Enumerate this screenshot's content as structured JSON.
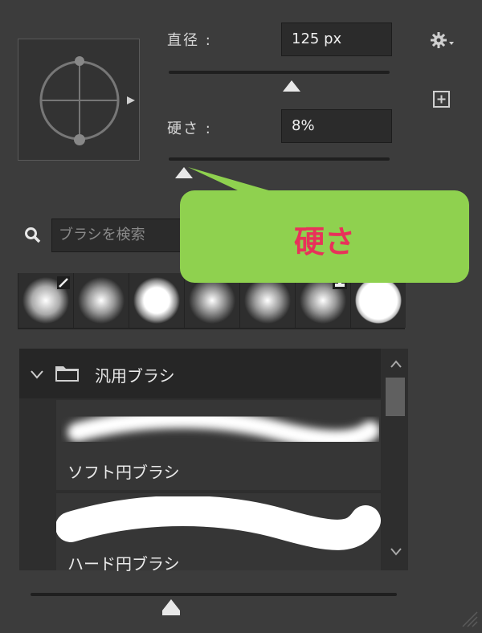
{
  "brush_settings": {
    "size_label": "直径 :",
    "size_value": "125 px",
    "size_level": 0.55,
    "hardness_label": "硬さ :",
    "hardness_value": "8%",
    "hardness_level": 0.08,
    "gear_icon": "gear-icon",
    "new_preset_icon": "plus-square-icon"
  },
  "search": {
    "placeholder": "ブラシを検索"
  },
  "callout": {
    "text": "硬さ",
    "color": "#8fd14f",
    "text_color": "#e8325a"
  },
  "brush_list": {
    "folder_name": "汎用ブラシ",
    "items": [
      {
        "name": "ソフト円ブラシ"
      },
      {
        "name": "ハード円ブラシ"
      }
    ]
  },
  "bottom_slider_level": 0.37
}
